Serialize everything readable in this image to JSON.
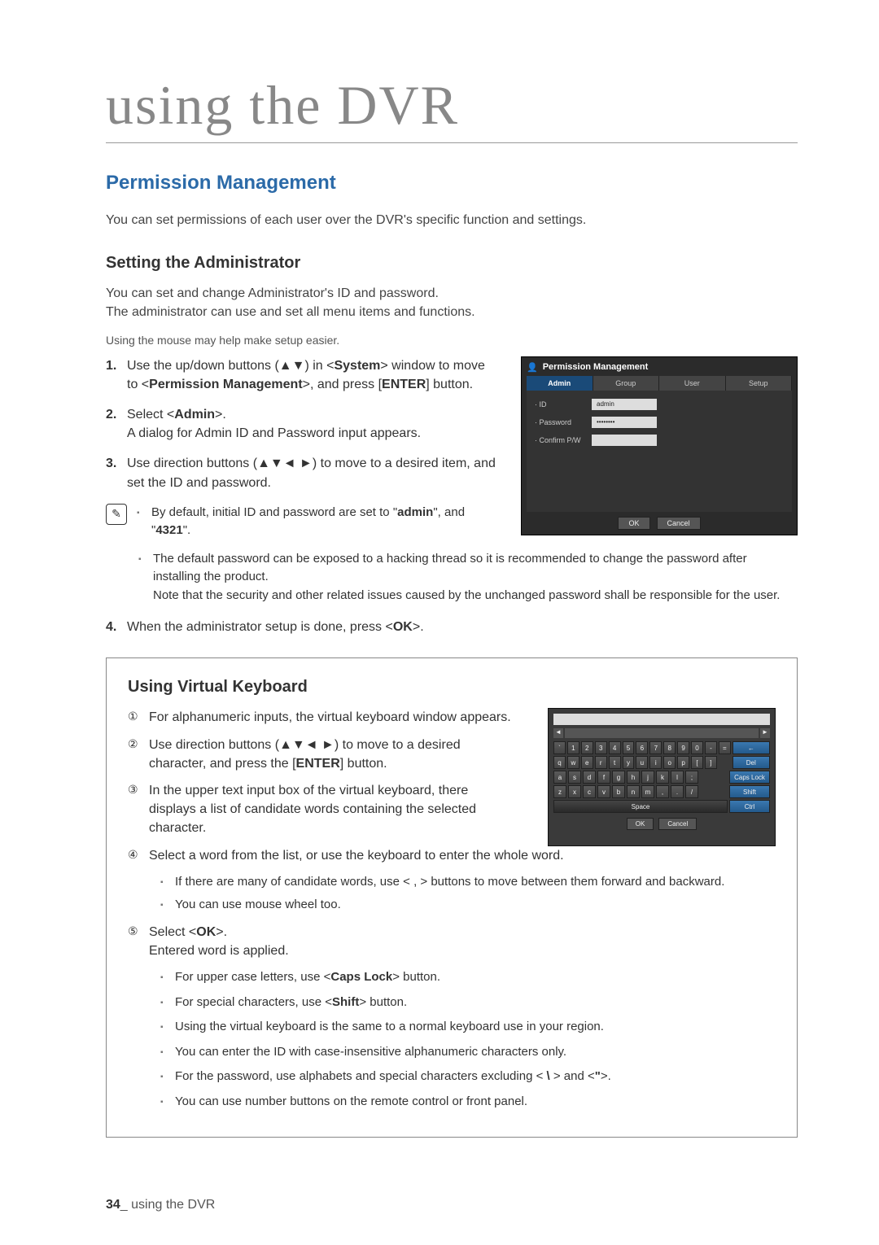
{
  "page_title": "using the DVR",
  "section_heading": "Permission Management",
  "intro1": "You can set permissions of each user over the DVR's specific function and settings.",
  "sub_heading1": "Setting the Administrator",
  "admin_intro_line1": "You can set and change Administrator's ID and password.",
  "admin_intro_line2": "The administrator can use and set all menu items and functions.",
  "mouse_note": "Using the mouse may help make setup easier.",
  "steps": {
    "s1_a": "Use the up/down buttons (▲▼) in <",
    "s1_b": "System",
    "s1_c": "> window to move to <",
    "s1_d": "Permission Management",
    "s1_e": ">, and press [",
    "s1_f": "ENTER",
    "s1_g": "] button.",
    "s2_a": "Select <",
    "s2_b": "Admin",
    "s2_c": ">. ",
    "s2_d": "A dialog for Admin ID and Password input appears.",
    "s3": "Use direction buttons (▲▼◄ ►) to move to a desired item, and set the ID and password.",
    "s4_a": "When the administrator setup is done, press <",
    "s4_b": "OK",
    "s4_c": ">."
  },
  "note1_a": "By default, initial ID and password are set to \"",
  "note1_b": "admin",
  "note1_c": "\", and \"",
  "note1_d": "4321",
  "note1_e": "\".",
  "note2": "The default password can be exposed to a hacking thread so it is recommended to change the password after installing the product.",
  "note2b": "Note that the security and other related issues caused by the unchanged password shall be responsible for the user.",
  "dialog": {
    "title": "Permission Management",
    "tabs": [
      "Admin",
      "Group",
      "User",
      "Setup"
    ],
    "rows": {
      "id_label": "· ID",
      "id_value": "admin",
      "pw_label": "· Password",
      "pw_value": "••••••••",
      "cpw_label": "· Confirm P/W",
      "cpw_value": ""
    },
    "btn_ok": "OK",
    "btn_cancel": "Cancel"
  },
  "vk_heading": "Using Virtual Keyboard",
  "vk_steps": {
    "c1": "For alphanumeric inputs, the virtual keyboard window appears.",
    "c2_a": "Use direction buttons (▲▼◄ ►) to move to a desired character, and press the [",
    "c2_b": "ENTER",
    "c2_c": "] button.",
    "c3": "In the upper text input box of the virtual keyboard, there displays a list of candidate words containing the selected character.",
    "c4": "Select a word from the list, or use the keyboard to enter the whole word.",
    "c5_a": "Select <",
    "c5_b": "OK",
    "c5_c": ">.",
    "c5_d": "Entered word is applied."
  },
  "vk_notes1": [
    "If there are many of candidate words, use <  ,  > buttons to move between them forward and backward.",
    "You can use mouse wheel too."
  ],
  "vk_notes2_a": "For upper case letters, use <",
  "vk_notes2_b": "Caps Lock",
  "vk_notes2_c": "> button.",
  "vk_notes3_a": "For special characters, use <",
  "vk_notes3_b": "Shift",
  "vk_notes3_c": "> button.",
  "vk_notes4": "Using the virtual keyboard is the same to a normal keyboard use in your region.",
  "vk_notes5": "You can enter the ID with case-insensitive alphanumeric characters only.",
  "vk_notes6_a": "For the password, use alphabets and special characters excluding < ",
  "vk_notes6_b": "\\",
  "vk_notes6_c": " > and <",
  "vk_notes6_d": "\"",
  "vk_notes6_e": ">.",
  "vk_notes7": "You can use number buttons on the remote control or front panel.",
  "keyboard": {
    "row1": [
      "`",
      "1",
      "2",
      "3",
      "4",
      "5",
      "6",
      "7",
      "8",
      "9",
      "0",
      "-",
      "=",
      "←"
    ],
    "row2": [
      "q",
      "w",
      "e",
      "r",
      "t",
      "y",
      "u",
      "i",
      "o",
      "p",
      "[",
      "]",
      "",
      "Del"
    ],
    "row3": [
      "a",
      "s",
      "d",
      "f",
      "g",
      "h",
      "j",
      "k",
      "l",
      ";",
      "",
      "",
      "Caps Lock"
    ],
    "row4": [
      "z",
      "x",
      "c",
      "v",
      "b",
      "n",
      "m",
      ",",
      ".",
      "/",
      "",
      "",
      "Shift"
    ],
    "space": "Space",
    "ctrl": "Ctrl",
    "ok": "OK",
    "cancel": "Cancel"
  },
  "footer_page": "34",
  "footer_text": "_ using the DVR"
}
